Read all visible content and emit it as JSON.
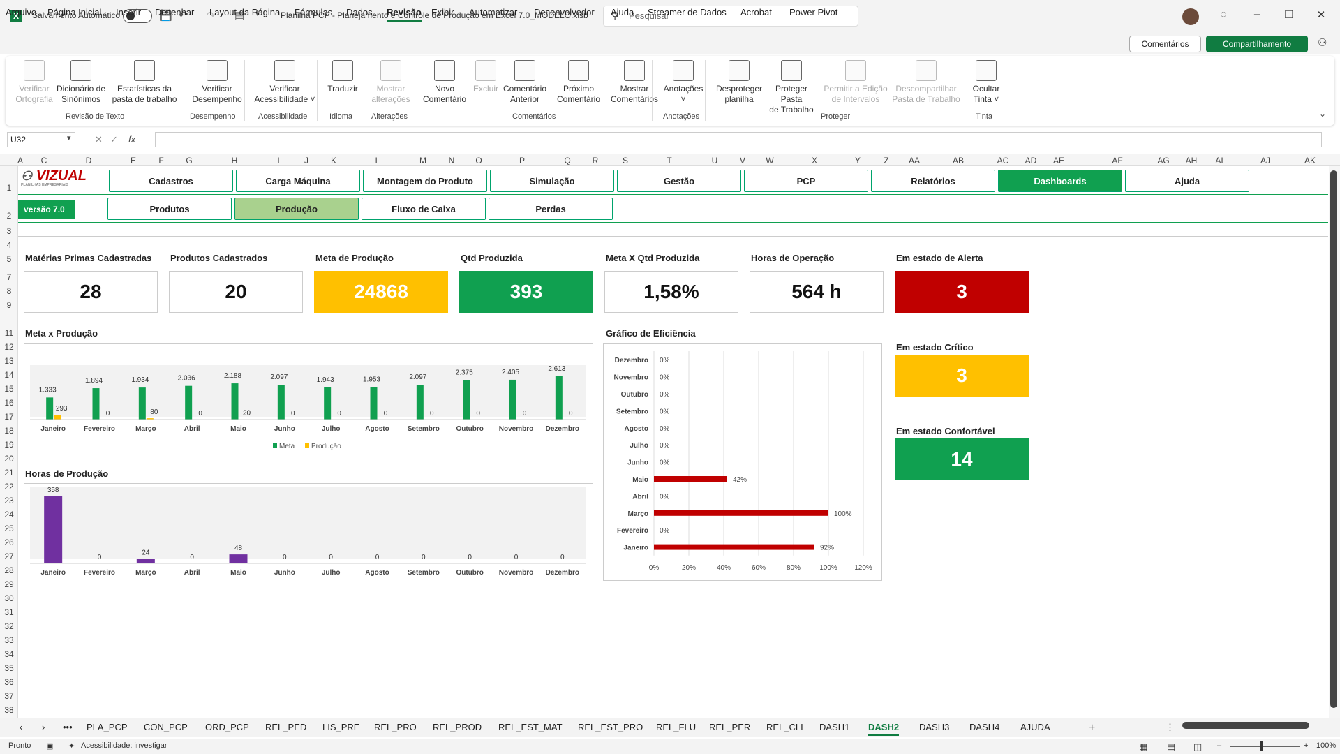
{
  "titlebar": {
    "autosave_label": "Salvamento Automático",
    "file_title": "Planilha PCP - Planejamento e Controle de Produção em Excel 7.0_MODELO.xlsb",
    "search_placeholder": "Pesquisar"
  },
  "menu": {
    "items": [
      "Arquivo",
      "Página Inicial",
      "Inserir",
      "Desenhar",
      "Layout da Página",
      "Fórmulas",
      "Dados",
      "Revisão",
      "Exibir",
      "Automatizar",
      "Desenvolvedor",
      "Ajuda",
      "Streamer de Dados",
      "Acrobat",
      "Power Pivot"
    ],
    "active": "Revisão",
    "comments_button": "Comentários",
    "share_button": "Compartilhamento"
  },
  "ribbon": {
    "buttons": [
      {
        "l1": "Verificar",
        "l2": "Ortografia",
        "disabled": true
      },
      {
        "l1": "Dicionário de",
        "l2": "Sinônimos",
        "disabled": false
      },
      {
        "l1": "Estatísticas da",
        "l2": "pasta de trabalho",
        "disabled": false
      },
      {
        "l1": "Verificar",
        "l2": "Desempenho",
        "disabled": false
      },
      {
        "l1": "Verificar",
        "l2": "Acessibilidade ˅",
        "disabled": false
      },
      {
        "l1": "Traduzir",
        "l2": "",
        "disabled": false
      },
      {
        "l1": "Mostrar",
        "l2": "alterações",
        "disabled": true
      },
      {
        "l1": "Novo",
        "l2": "Comentário",
        "disabled": false
      },
      {
        "l1": "Excluir",
        "l2": "",
        "disabled": true
      },
      {
        "l1": "Comentário",
        "l2": "Anterior",
        "disabled": false
      },
      {
        "l1": "Próximo",
        "l2": "Comentário",
        "disabled": false
      },
      {
        "l1": "Mostrar",
        "l2": "Comentários",
        "disabled": false
      },
      {
        "l1": "Anotações",
        "l2": "˅",
        "disabled": false
      },
      {
        "l1": "Desproteger",
        "l2": "planilha",
        "disabled": false
      },
      {
        "l1": "Proteger Pasta",
        "l2": "de Trabalho",
        "disabled": false
      },
      {
        "l1": "Permitir a Edição",
        "l2": "de Intervalos",
        "disabled": true
      },
      {
        "l1": "Descompartilhar",
        "l2": "Pasta de Trabalho",
        "disabled": true
      },
      {
        "l1": "Ocultar",
        "l2": "Tinta ˅",
        "disabled": false
      }
    ],
    "groups": [
      "Revisão de Texto",
      "Desempenho",
      "Acessibilidade",
      "Idioma",
      "Alterações",
      "Comentários",
      "Anotações",
      "Proteger",
      "Tinta"
    ]
  },
  "formula_bar": {
    "name_box": "U32",
    "fx": "fx",
    "value": ""
  },
  "columns": [
    "A",
    "C",
    "D",
    "E",
    "F",
    "G",
    "H",
    "I",
    "J",
    "K",
    "L",
    "M",
    "N",
    "O",
    "P",
    "Q",
    "R",
    "S",
    "T",
    "U",
    "V",
    "W",
    "X",
    "Y",
    "Z",
    "AA",
    "AB",
    "AC",
    "AD",
    "AE",
    "AF",
    "AG",
    "AH",
    "AI",
    "AJ",
    "AK"
  ],
  "rows": [
    "1",
    "2",
    "3",
    "4",
    "5",
    "7",
    "8",
    "9",
    "11",
    "12",
    "13",
    "14",
    "15",
    "16",
    "17",
    "18",
    "19",
    "20",
    "21",
    "22",
    "23",
    "24",
    "25",
    "26",
    "27",
    "28",
    "29",
    "30",
    "31",
    "32",
    "33",
    "34",
    "35",
    "36",
    "37",
    "38"
  ],
  "dashboard": {
    "logo": "VIZUAL",
    "logo_tagline": "PLANILHAS EMPRESARIAIS",
    "version": "versão 7.0",
    "nav_top": [
      "Cadastros",
      "Carga Máquina",
      "Montagem do Produto",
      "Simulação",
      "Gestão",
      "PCP",
      "Relatórios",
      "Dashboards",
      "Ajuda"
    ],
    "nav_top_active": "Dashboards",
    "nav_sub": [
      "Produtos",
      "Produção",
      "Fluxo de Caixa",
      "Perdas"
    ],
    "nav_sub_selected": "Produção",
    "kpis": [
      {
        "label": "Matérias Primas Cadastradas",
        "value": "28",
        "style": "plain"
      },
      {
        "label": "Produtos Cadastrados",
        "value": "20",
        "style": "plain"
      },
      {
        "label": "Meta de Produção",
        "value": "24868",
        "style": "orange"
      },
      {
        "label": "Qtd Produzida",
        "value": "393",
        "style": "green"
      },
      {
        "label": "Meta X Qtd Produzida",
        "value": "1,58%",
        "style": "plain"
      },
      {
        "label": "Horas de Operação",
        "value": "564 h",
        "style": "plain"
      },
      {
        "label": "Em estado de Alerta",
        "value": "3",
        "style": "red"
      }
    ],
    "status_cards": [
      {
        "label": "Em estado Crítico",
        "value": "3",
        "style": "orange"
      },
      {
        "label": "Em estado Confortável",
        "value": "14",
        "style": "green"
      }
    ],
    "chart_titles": {
      "meta": "Meta x Produção",
      "horas": "Horas de Produção",
      "eficiencia": "Gráfico de Eficiência"
    }
  },
  "colors": {
    "green": "#10a050",
    "orange": "#ffc000",
    "red": "#c00000",
    "purple": "#7030a0",
    "excel_green": "#107c41"
  },
  "chart_data": [
    {
      "type": "bar",
      "title": "Meta x Produção",
      "categories": [
        "Janeiro",
        "Fevereiro",
        "Março",
        "Abril",
        "Maio",
        "Junho",
        "Julho",
        "Agosto",
        "Setembro",
        "Outubro",
        "Novembro",
        "Dezembro"
      ],
      "series": [
        {
          "name": "Meta",
          "values": [
            1333,
            1894,
            1934,
            2036,
            2188,
            2097,
            1943,
            1953,
            2097,
            2375,
            2405,
            2613
          ],
          "labels": [
            "1.333",
            "1.894",
            "1.934",
            "2.036",
            "2.188",
            "2.097",
            "1.943",
            "1.953",
            "2.097",
            "2.375",
            "2.405",
            "2.613"
          ]
        },
        {
          "name": "Produção",
          "values": [
            293,
            0,
            80,
            0,
            20,
            0,
            0,
            0,
            0,
            0,
            0,
            0
          ],
          "labels": [
            "293",
            "0",
            "80",
            "0",
            "20",
            "0",
            "0",
            "0",
            "0",
            "0",
            "0",
            "0"
          ]
        }
      ],
      "legend": "bottom"
    },
    {
      "type": "bar",
      "title": "Horas de Produção",
      "categories": [
        "Janeiro",
        "Fevereiro",
        "Março",
        "Abril",
        "Maio",
        "Junho",
        "Julho",
        "Agosto",
        "Setembro",
        "Outubro",
        "Novembro",
        "Dezembro"
      ],
      "values": [
        358,
        0,
        24,
        0,
        48,
        0,
        0,
        0,
        0,
        0,
        0,
        0
      ]
    },
    {
      "type": "bar",
      "orientation": "horizontal",
      "title": "Gráfico de Eficiência",
      "categories": [
        "Dezembro",
        "Novembro",
        "Outubro",
        "Setembro",
        "Agosto",
        "Julho",
        "Junho",
        "Maio",
        "Abril",
        "Março",
        "Fevereiro",
        "Janeiro"
      ],
      "values": [
        0,
        0,
        0,
        0,
        0,
        0,
        0,
        42,
        0,
        100,
        0,
        92
      ],
      "labels": [
        "0%",
        "0%",
        "0%",
        "0%",
        "0%",
        "0%",
        "0%",
        "42%",
        "0%",
        "100%",
        "0%",
        "92%"
      ],
      "xlim": [
        0,
        120
      ],
      "xticks": [
        "0%",
        "20%",
        "40%",
        "60%",
        "80%",
        "100%",
        "120%"
      ],
      "grid": true
    }
  ],
  "sheet_tabs": {
    "tabs": [
      "PLA_PCP",
      "CON_PCP",
      "ORD_PCP",
      "REL_PED",
      "LIS_PRE",
      "REL_PRO",
      "REL_PROD",
      "REL_EST_MAT",
      "REL_EST_PRO",
      "REL_FLU",
      "REL_PER",
      "REL_CLI",
      "DASH1",
      "DASH2",
      "DASH3",
      "DASH4",
      "AJUDA"
    ],
    "active": "DASH2"
  },
  "status": {
    "ready": "Pronto",
    "accessibility": "Acessibilidade: investigar",
    "zoom": "100%"
  }
}
